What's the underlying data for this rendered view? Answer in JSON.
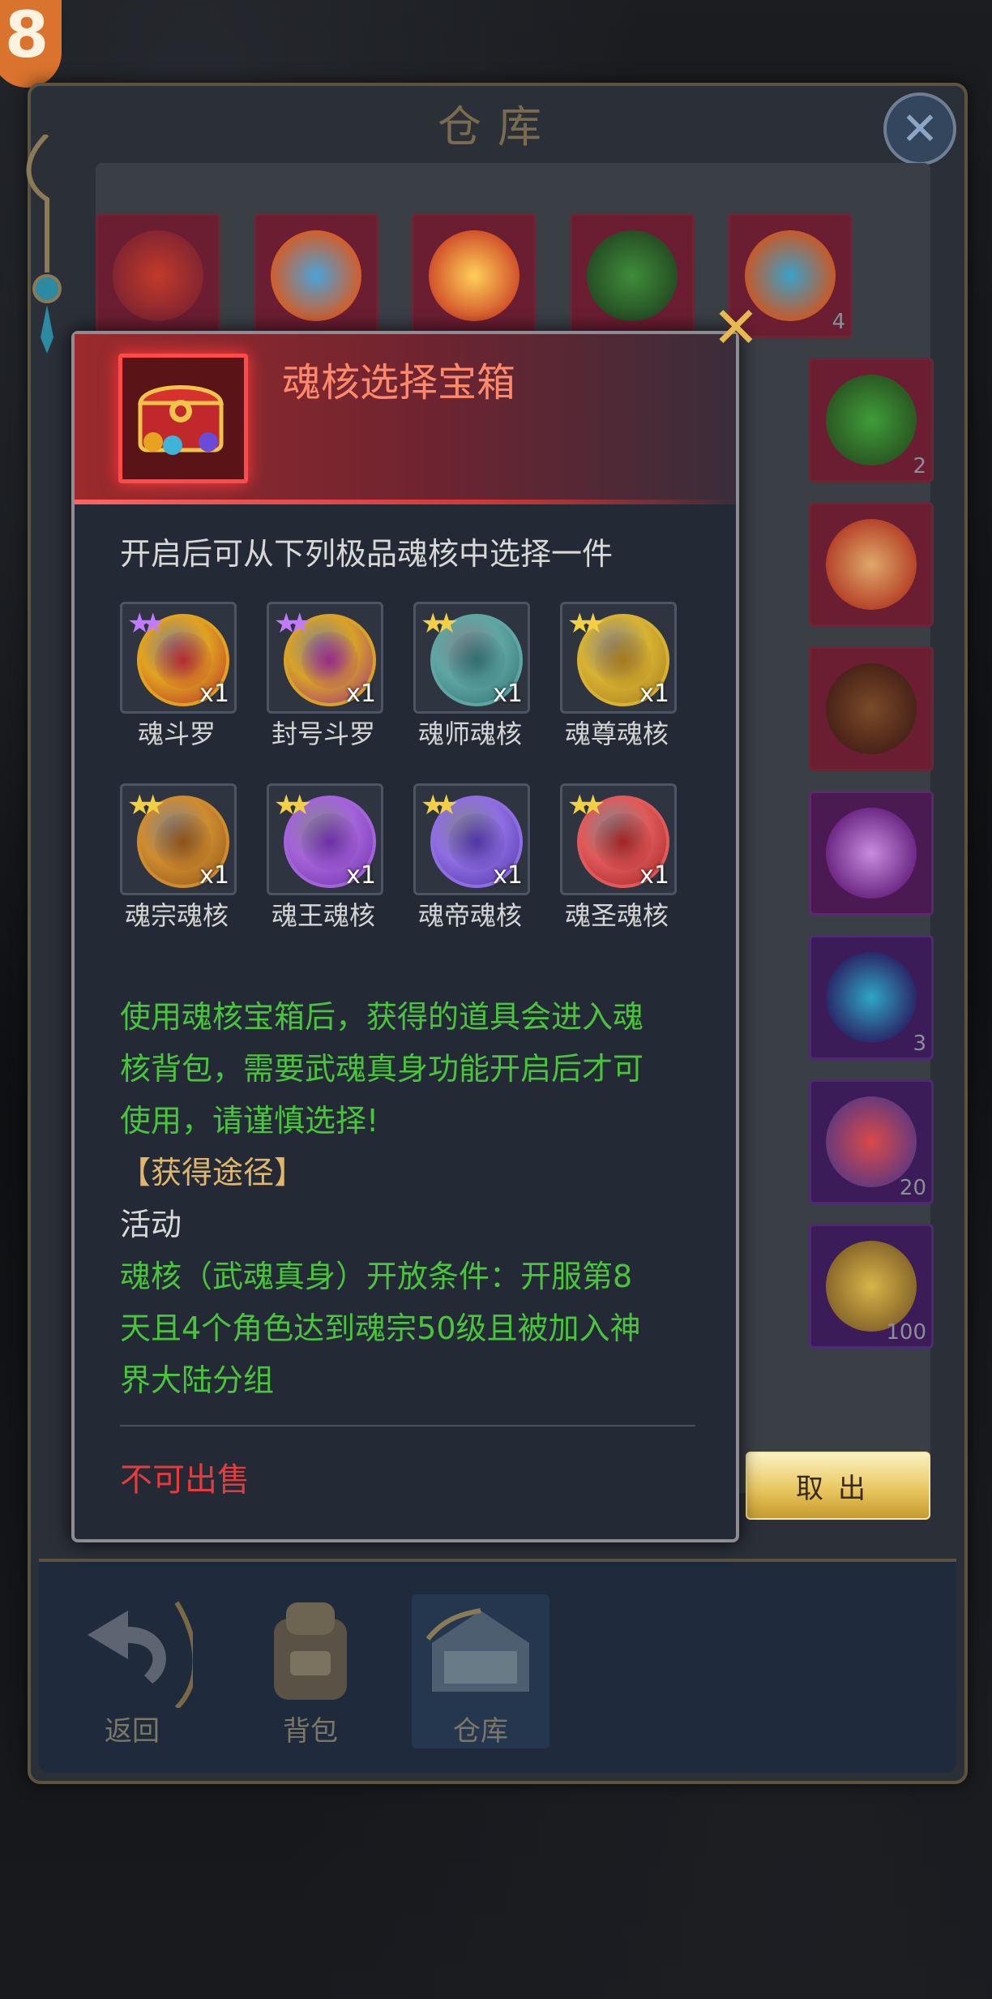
{
  "corner_badge": "8",
  "warehouse": {
    "title": "仓库",
    "close_icon": "close-icon",
    "slot_counts": [
      "4",
      "2",
      "3",
      "20",
      "100"
    ],
    "nav": [
      {
        "label": "返回",
        "icon": "return-arrow-icon"
      },
      {
        "label": "背包",
        "icon": "backpack-icon"
      },
      {
        "label": "仓库",
        "icon": "warehouse-chest-icon"
      }
    ],
    "take_out_label": "取出"
  },
  "popup": {
    "title": "魂核选择宝箱",
    "icon": "treasure-chest-icon",
    "close_icon": "close-x-icon",
    "subtitle": "开启后可从下列极品魂核中选择一件",
    "cores": [
      {
        "name": "魂斗罗",
        "qty": "x1",
        "stars": 2,
        "star_color": "#c27bff",
        "orb": "#e2a21f",
        "inner": "#b32c2f"
      },
      {
        "name": "封号斗罗",
        "qty": "x1",
        "stars": 2,
        "star_color": "#c27bff",
        "orb": "#d9a227",
        "inner": "#9a2a86"
      },
      {
        "name": "魂师魂核",
        "qty": "x1",
        "stars": 2,
        "star_color": "#f2d046",
        "orb": "#5fa6a3",
        "inner": "#2f6e72"
      },
      {
        "name": "魂尊魂核",
        "qty": "x1",
        "stars": 2,
        "star_color": "#f2d046",
        "orb": "#d7b232",
        "inner": "#a77a1c"
      },
      {
        "name": "魂宗魂核",
        "qty": "x1",
        "stars": 2,
        "star_color": "#f2d046",
        "orb": "#cf8c2f",
        "inner": "#8e5217"
      },
      {
        "name": "魂王魂核",
        "qty": "x1",
        "stars": 2,
        "star_color": "#f2d046",
        "orb": "#a464d9",
        "inner": "#6e2ea8"
      },
      {
        "name": "魂帝魂核",
        "qty": "x1",
        "stars": 2,
        "star_color": "#f2d046",
        "orb": "#8f6ee2",
        "inner": "#4e35a6"
      },
      {
        "name": "魂圣魂核",
        "qty": "x1",
        "stars": 2,
        "star_color": "#f2d046",
        "orb": "#e05a5a",
        "inner": "#a32323"
      }
    ],
    "desc_line1": "使用魂核宝箱后，获得的道具会进入魂",
    "desc_line2": "核背包，需要武魂真身功能开启后才可",
    "desc_line3": "使用，请谨慎选择!",
    "obtain_header": "【获得途径】",
    "obtain_value": "活动",
    "cond_line1": "魂核（武魂真身）开放条件：开服第8",
    "cond_line2": "天且4个角色达到魂宗50级且被加入神",
    "cond_line3": "界大陆分组",
    "no_sell": "不可出售"
  }
}
